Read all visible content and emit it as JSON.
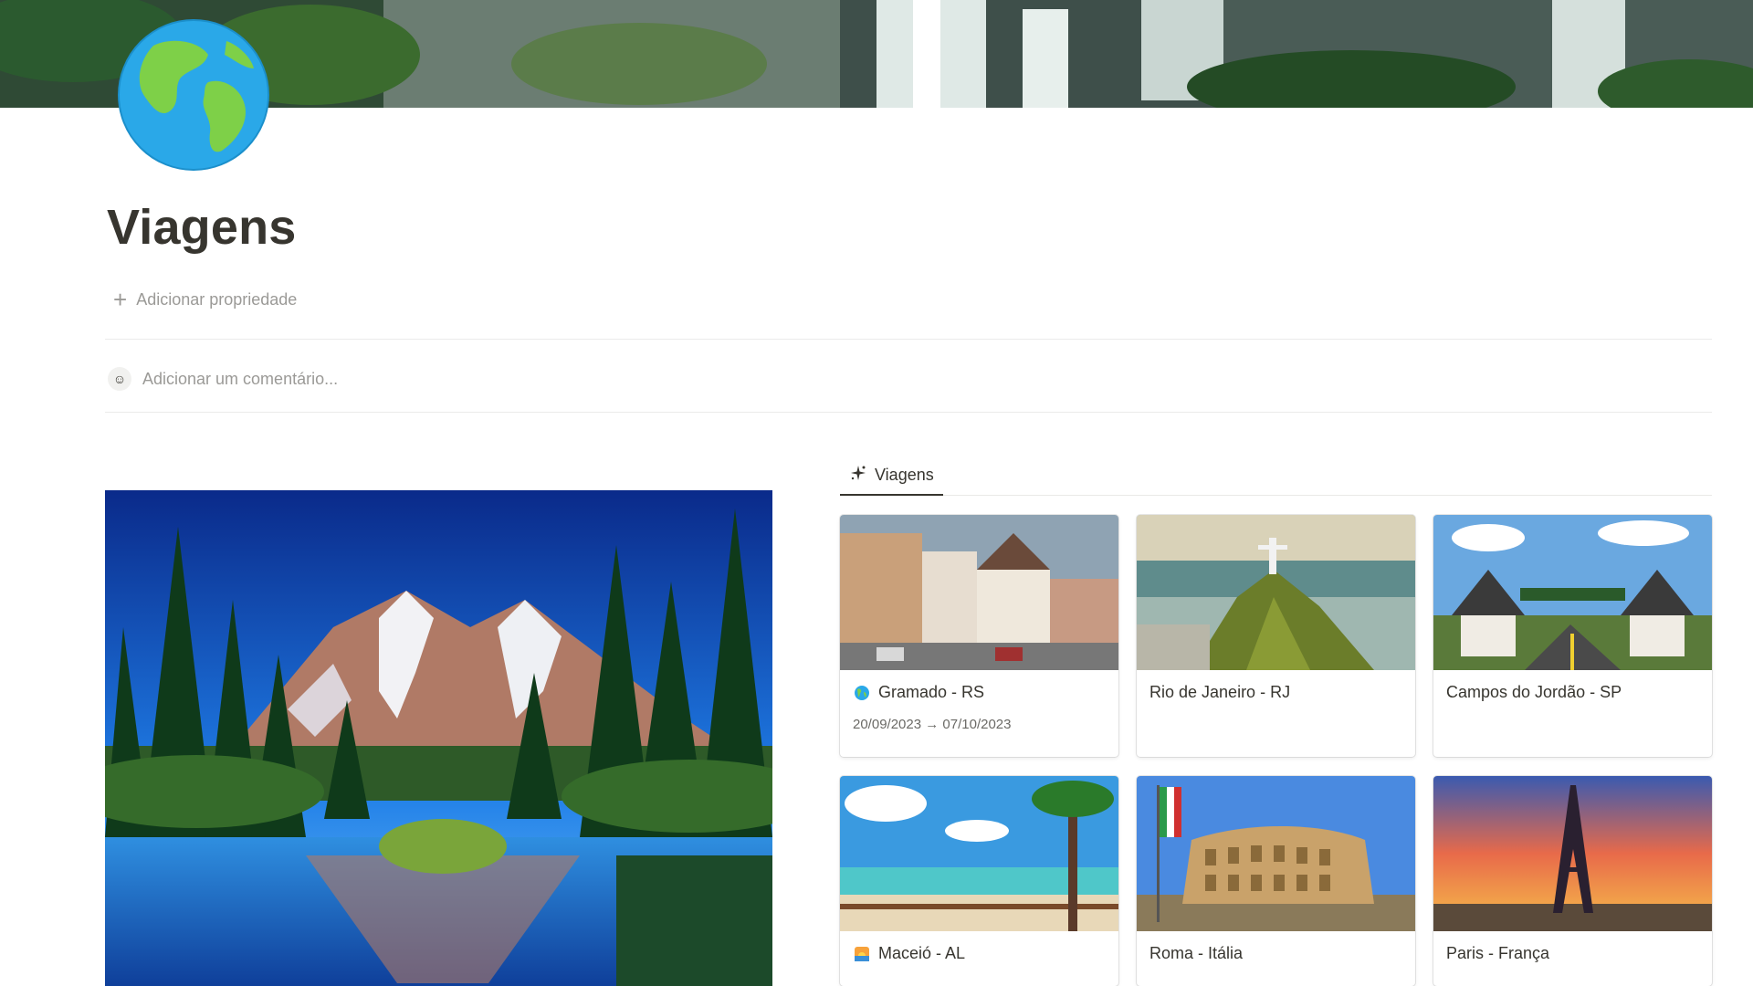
{
  "page": {
    "title": "Viagens",
    "icon": "globe-americas-icon",
    "add_property_label": "Adicionar propriedade",
    "comment_placeholder": "Adicionar um comentário..."
  },
  "gallery": {
    "view_tab_label": "Viagens",
    "view_tab_icon": "sparkle-icon",
    "cards": [
      {
        "title": "Gramado - RS",
        "icon": "globe-icon",
        "dates": "20/09/2023 → 07/10/2023"
      },
      {
        "title": "Rio de Janeiro - RJ",
        "icon": "",
        "dates": ""
      },
      {
        "title": "Campos do Jordão - SP",
        "icon": "",
        "dates": ""
      },
      {
        "title": "Maceió - AL",
        "icon": "sunset-icon",
        "dates": ""
      },
      {
        "title": "Roma - Itália",
        "icon": "",
        "dates": ""
      },
      {
        "title": "Paris - França",
        "icon": "",
        "dates": ""
      }
    ]
  },
  "colors": {
    "text": "#37352f",
    "muted": "#9b9a97",
    "divider": "#ebebea"
  }
}
